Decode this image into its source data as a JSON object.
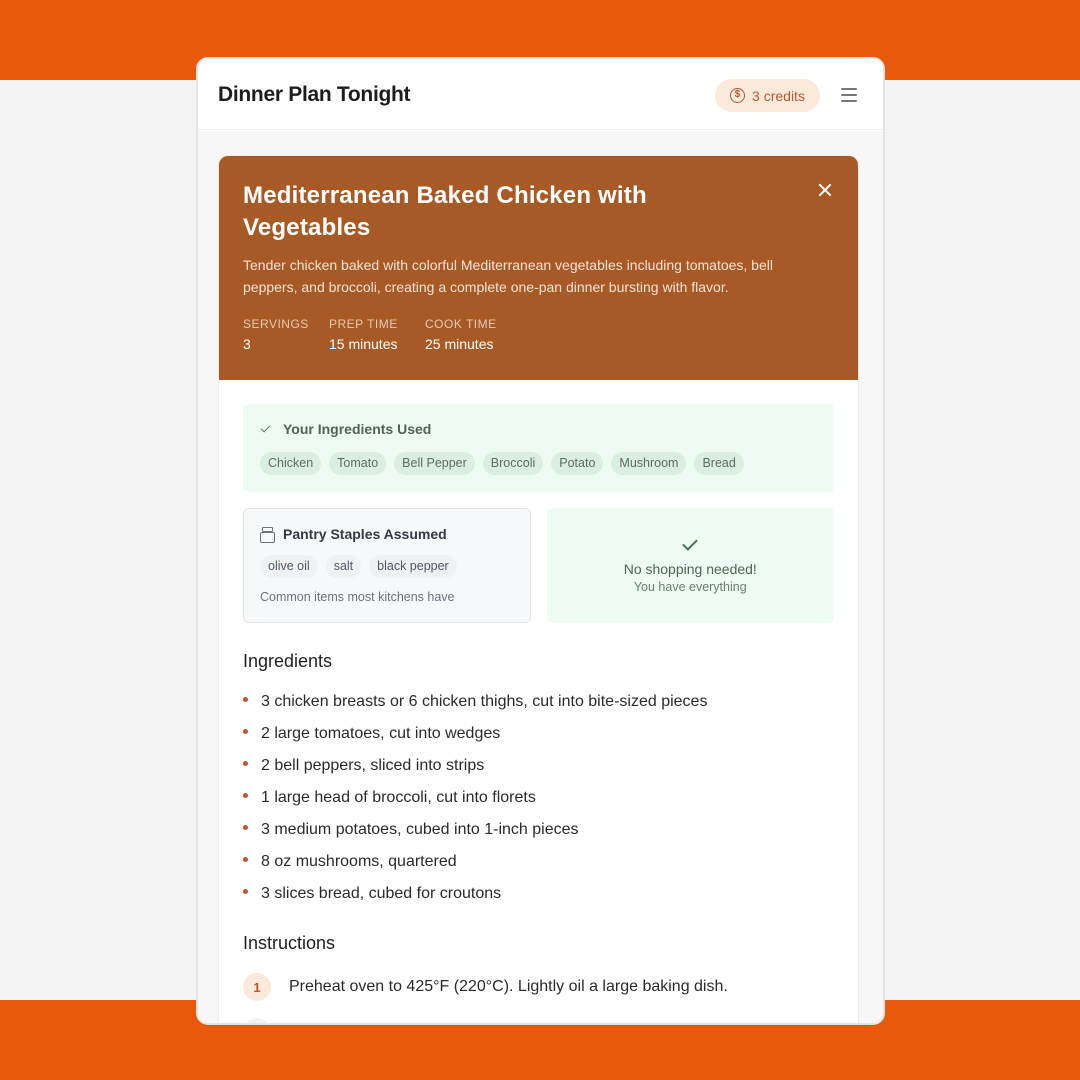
{
  "app": {
    "title": "Dinner Plan Tonight",
    "credits_label": "3 credits",
    "credits_icon": "coin-icon",
    "menu_icon": "menu-icon"
  },
  "recipe": {
    "title": "Mediterranean Baked Chicken with Vegetables",
    "description": "Tender chicken baked with colorful Mediterranean vegetables including tomatoes, bell peppers, and broccoli, creating a complete one-pan dinner bursting with flavor.",
    "meta": [
      {
        "label": "SERVINGS",
        "value": "3"
      },
      {
        "label": "PREP TIME",
        "value": "15 minutes"
      },
      {
        "label": "COOK TIME",
        "value": "25 minutes"
      }
    ],
    "header_color": "#a85a26"
  },
  "ingredients_used": {
    "title": "Your Ingredients Used",
    "items": [
      "Chicken",
      "Tomato",
      "Bell Pepper",
      "Broccoli",
      "Potato",
      "Mushroom",
      "Bread"
    ]
  },
  "pantry": {
    "title": "Pantry Staples Assumed",
    "items": [
      "olive oil",
      "salt",
      "black pepper"
    ],
    "note": "Common items most kitchens have"
  },
  "shopping": {
    "title": "No shopping needed!",
    "subtitle": "You have everything"
  },
  "ingredients": {
    "title": "Ingredients",
    "items": [
      "3 chicken breasts or 6 chicken thighs, cut into bite-sized pieces",
      "2 large tomatoes, cut into wedges",
      "2 bell peppers, sliced into strips",
      "1 large head of broccoli, cut into florets",
      "3 medium potatoes, cubed into 1-inch pieces",
      "8 oz mushrooms, quartered",
      "3 slices bread, cubed for croutons"
    ]
  },
  "instructions": {
    "title": "Instructions",
    "steps": [
      {
        "number": "1",
        "text": "Preheat oven to 425°F (220°C). Lightly oil a large baking dish."
      }
    ]
  },
  "colors": {
    "brand_orange": "#e8590c",
    "accent": "#b4592a",
    "success_bg": "#eefbf2"
  }
}
